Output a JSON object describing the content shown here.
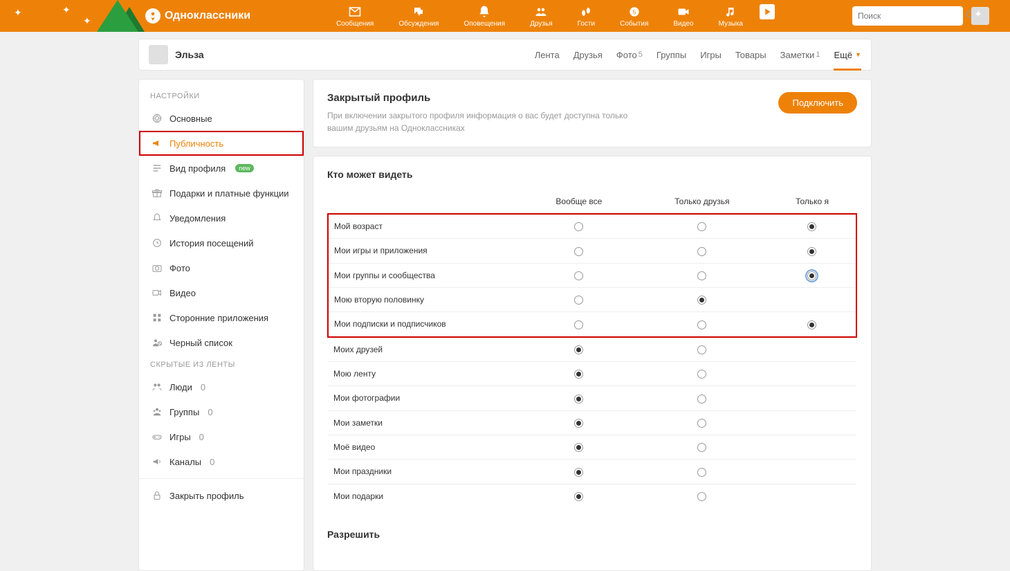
{
  "brand": "Одноклассники",
  "search": {
    "placeholder": "Поиск"
  },
  "topnav": [
    {
      "label": "Сообщения"
    },
    {
      "label": "Обсуждения"
    },
    {
      "label": "Оповещения"
    },
    {
      "label": "Друзья"
    },
    {
      "label": "Гости"
    },
    {
      "label": "События"
    },
    {
      "label": "Видео"
    },
    {
      "label": "Музыка"
    }
  ],
  "profile": {
    "name": "Эльза"
  },
  "tabs": [
    {
      "label": "Лента"
    },
    {
      "label": "Друзья"
    },
    {
      "label": "Фото",
      "count": "5"
    },
    {
      "label": "Группы"
    },
    {
      "label": "Игры"
    },
    {
      "label": "Товары"
    },
    {
      "label": "Заметки",
      "count": "1"
    },
    {
      "label": "Ещё",
      "active": true
    }
  ],
  "sidebar": {
    "settings_head": "НАСТРОЙКИ",
    "hidden_head": "СКРЫТЫЕ ИЗ ЛЕНТЫ",
    "items": {
      "basic": "Основные",
      "publicity": "Публичность",
      "profile_view": "Вид профиля",
      "profile_view_badge": "new",
      "gifts": "Подарки и платные функции",
      "notifications": "Уведомления",
      "history": "История посещений",
      "photo": "Фото",
      "video": "Видео",
      "apps": "Сторонние приложения",
      "blacklist": "Черный список",
      "people": "Люди",
      "people_count": "0",
      "groups": "Группы",
      "groups_count": "0",
      "games": "Игры",
      "games_count": "0",
      "channels": "Каналы",
      "channels_count": "0",
      "close_profile": "Закрыть профиль"
    }
  },
  "closed_profile": {
    "title": "Закрытый профиль",
    "desc": "При включении закрытого профиля информация о вас будет доступна только вашим друзьям на Одноклассниках",
    "button": "Подключить"
  },
  "privacy": {
    "title": "Кто может видеть",
    "cols": [
      "Вообще все",
      "Только друзья",
      "Только я"
    ],
    "rows": [
      {
        "label": "Мой возраст",
        "selected": 2,
        "hl": true
      },
      {
        "label": "Мои игры и приложения",
        "selected": 2,
        "hl": true
      },
      {
        "label": "Мои группы и сообщества",
        "selected": 2,
        "hl": true,
        "focused": true
      },
      {
        "label": "Мою вторую половинку",
        "selected": 1,
        "hl": true,
        "noLast": true
      },
      {
        "label": "Мои подписки и подписчиков",
        "selected": 2,
        "hl": true
      },
      {
        "label": "Моих друзей",
        "selected": 0,
        "noLast": true
      },
      {
        "label": "Мою ленту",
        "selected": 0,
        "noLast": true
      },
      {
        "label": "Мои фотографии",
        "selected": 0,
        "noLast": true
      },
      {
        "label": "Мои заметки",
        "selected": 0,
        "noLast": true
      },
      {
        "label": "Моё видео",
        "selected": 0,
        "noLast": true
      },
      {
        "label": "Мои праздники",
        "selected": 0,
        "noLast": true
      },
      {
        "label": "Мои подарки",
        "selected": 0,
        "noLast": true
      }
    ]
  },
  "allow": {
    "title": "Разрешить"
  }
}
